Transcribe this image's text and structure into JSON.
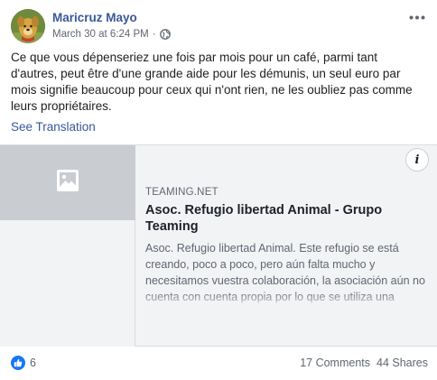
{
  "post": {
    "author": "Maricruz Mayo",
    "timestamp": "March 30 at 6:24 PM",
    "separator": "·",
    "privacy_icon": "globe-icon",
    "more_icon": "more-options-icon",
    "body": "Ce que vous dépenseriez une fois par mois pour un café, parmi tant d'autres, peut être d'une grande aide pour les démunis, un seul euro par mois signifie beaucoup pour ceux qui n'ont rien, ne les oubliez pas comme leurs propriétaires.",
    "see_translation": "See Translation"
  },
  "attachment": {
    "thumbnail_icon": "image-placeholder-icon",
    "domain": "TEAMING.NET",
    "title": "Asoc. Refugio libertad Animal - Grupo Teaming",
    "description": "Asoc. Refugio libertad Animal. Este refugio se está creando, poco a poco, pero aún falta mucho y necesitamos vuestra colaboración, la asociación aún no cuenta con cuenta propia por lo que se utiliza una cuenta bancaria de la fundadora de la asociación",
    "info_label": "i"
  },
  "footer": {
    "reaction_icon": "like-icon",
    "reaction_count": "6",
    "comments": "17 Comments",
    "shares": "44 Shares"
  },
  "colors": {
    "link_blue": "#385898",
    "like_blue": "#1877f2",
    "secondary_text": "#606770",
    "attachment_bg": "#f2f3f5",
    "thumb_bg": "#c9ccd1"
  }
}
